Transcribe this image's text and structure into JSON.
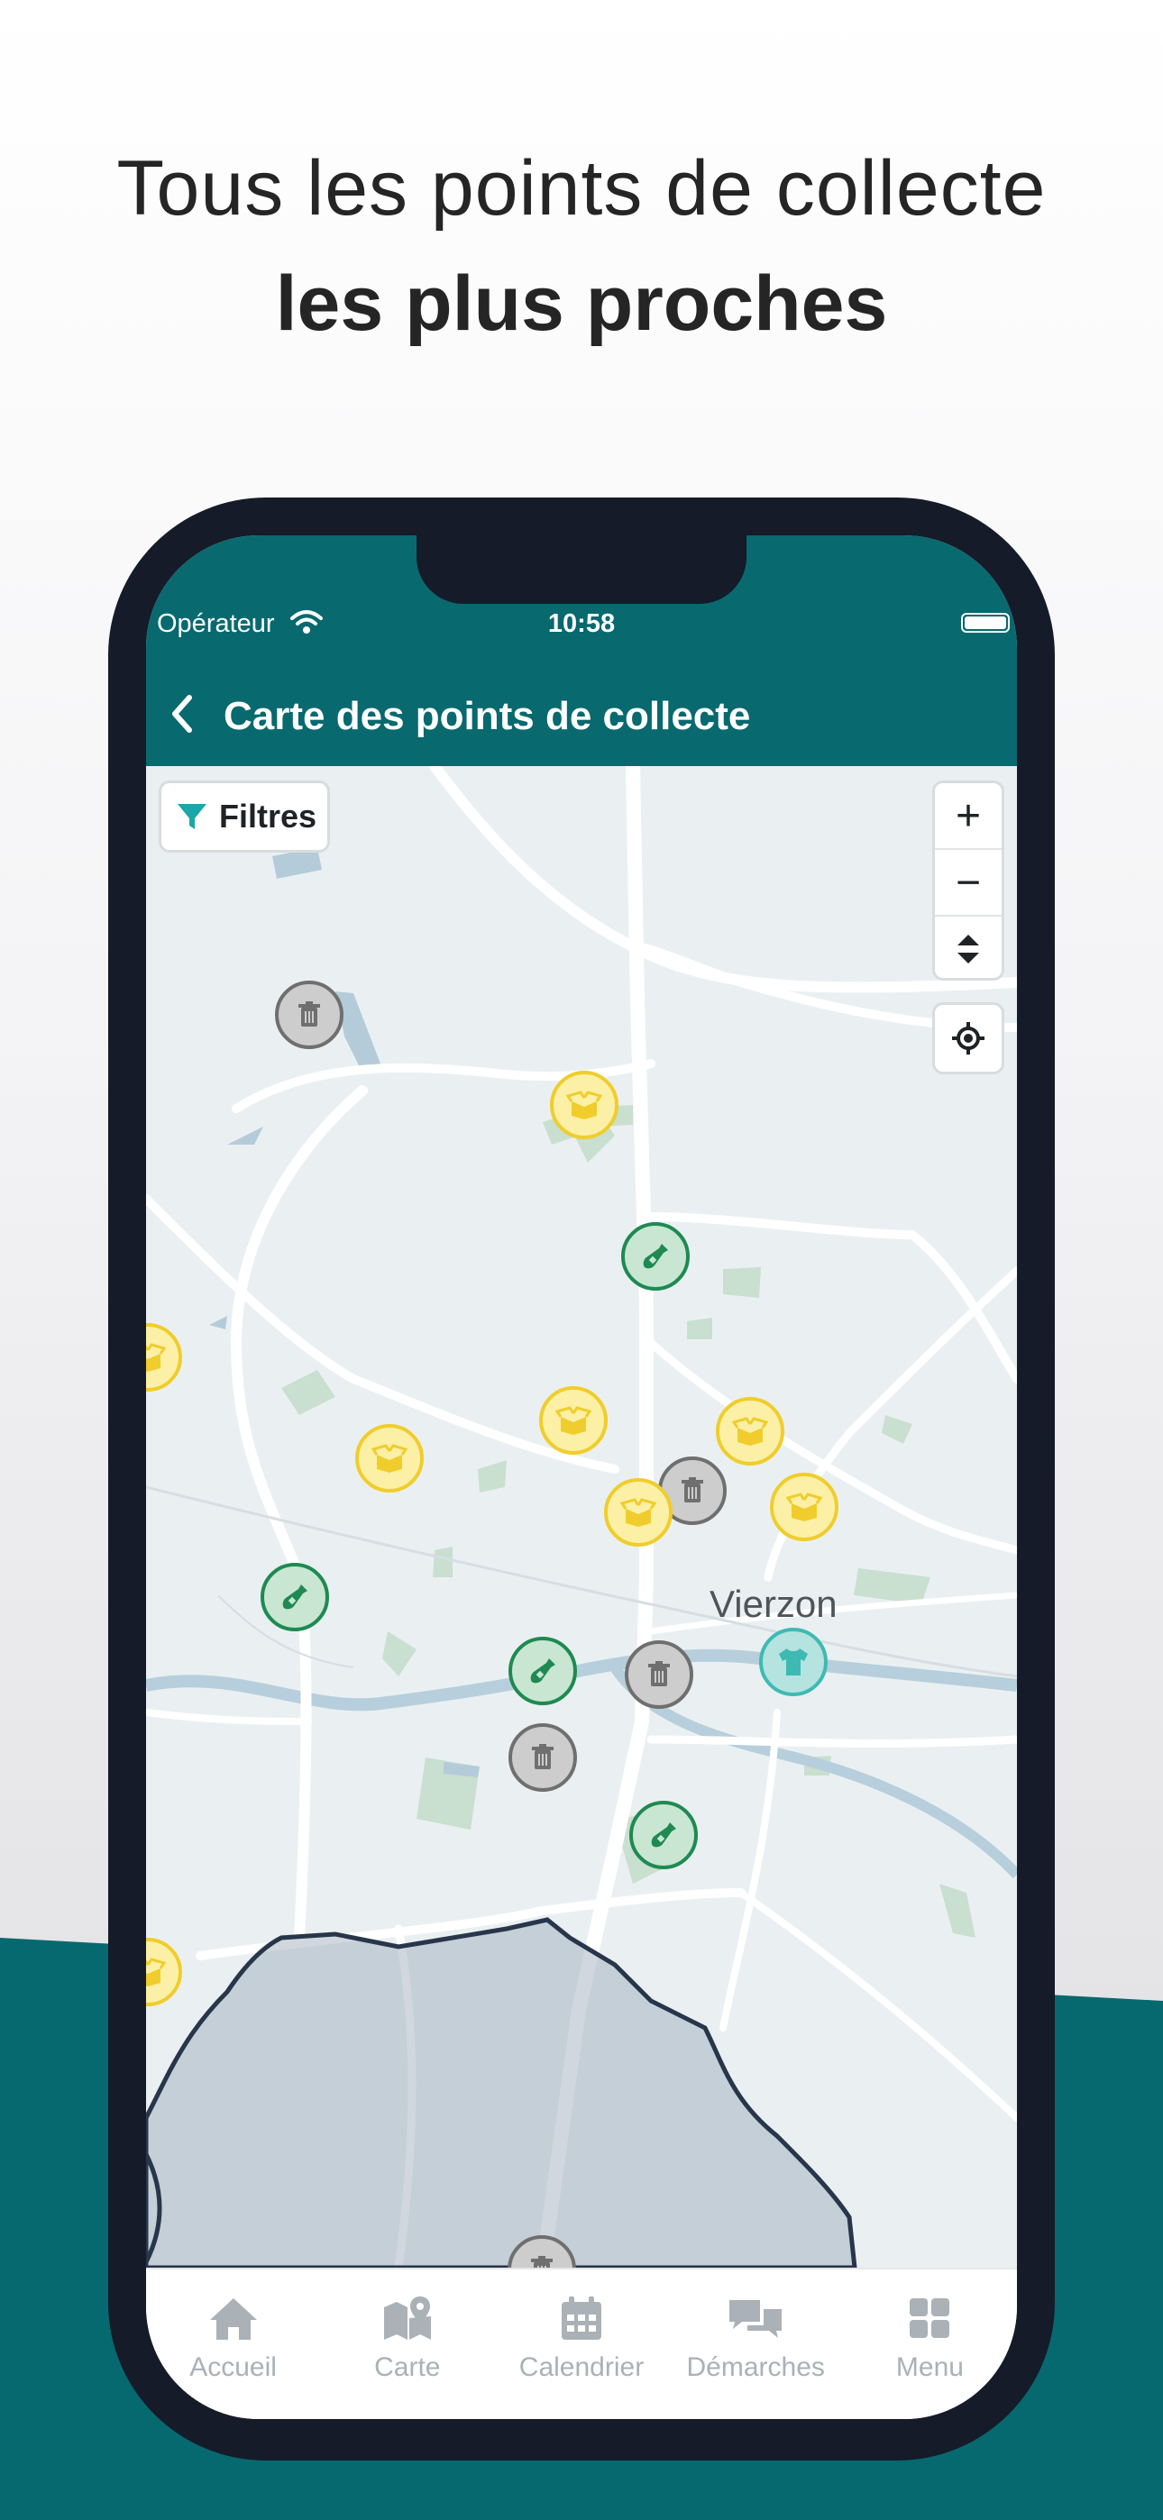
{
  "headline": {
    "line1": "Tous les points de collecte",
    "line2": "les plus proches"
  },
  "status_bar": {
    "operator": "Opérateur",
    "time": "10:58"
  },
  "nav": {
    "title": "Carte des points de collecte"
  },
  "map": {
    "filter_label": "Filtres",
    "zoom_in": "+",
    "zoom_out": "−",
    "place_label": "Vierzon"
  },
  "markers": [
    {
      "type": "trash",
      "color": "gray",
      "icon": "trash-icon"
    },
    {
      "type": "packaging",
      "color": "yellow",
      "icon": "box-icon"
    },
    {
      "type": "glass",
      "color": "green",
      "icon": "bottle-icon"
    },
    {
      "type": "clothes",
      "color": "teal",
      "icon": "tshirt-icon"
    }
  ],
  "colors": {
    "brand_teal": "#08696f",
    "trash_gray": "#6f6f6f",
    "packaging_yellow": "#f0cd2c",
    "glass_green": "#1e8a52",
    "clothes_teal": "#3ebab3",
    "filter_icon": "#1aa7a8"
  },
  "tabs": [
    {
      "label": "Accueil",
      "icon": "home-icon"
    },
    {
      "label": "Carte",
      "icon": "map-icon"
    },
    {
      "label": "Calendrier",
      "icon": "calendar-icon"
    },
    {
      "label": "Démarches",
      "icon": "chat-icon"
    },
    {
      "label": "Menu",
      "icon": "grid-icon"
    }
  ]
}
